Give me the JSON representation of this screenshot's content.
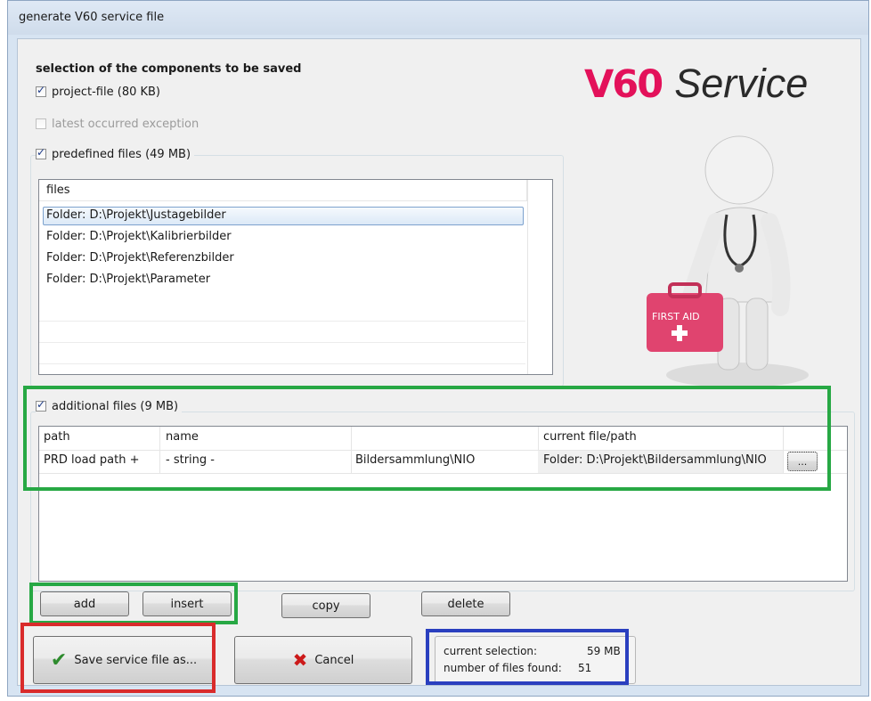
{
  "window": {
    "title": "generate V60 service file"
  },
  "selection_heading": "selection of the components to be saved",
  "checkboxes": {
    "project_file": "project-file (80 KB)",
    "latest_exception": "latest occurred exception",
    "predefined_files": "predefined files (49 MB)",
    "additional_files": "additional files (9 MB)"
  },
  "logo": {
    "brand": "V60",
    "product": "Service"
  },
  "illustration": {
    "kit_label": "FIRST AID"
  },
  "predefined_list": {
    "header": "files",
    "items": [
      "Folder: D:\\Projekt\\Justagebilder",
      "Folder: D:\\Projekt\\Kalibrierbilder",
      "Folder: D:\\Projekt\\Referenzbilder",
      "Folder: D:\\Projekt\\Parameter"
    ]
  },
  "additional_table": {
    "headers": [
      "path",
      "name",
      "",
      "current file/path"
    ],
    "rows": [
      [
        "PRD load path +",
        "- string -",
        "Bildersammlung\\NIO",
        "Folder: D:\\Projekt\\Bildersammlung\\NIO"
      ]
    ],
    "browse_label": "..."
  },
  "buttons": {
    "add": "add",
    "insert": "insert",
    "copy": "copy",
    "delete": "delete",
    "save": "Save service file as...",
    "cancel": "Cancel"
  },
  "stats": {
    "current_selection_label": "current selection:",
    "current_selection_value": "59 MB",
    "files_found_label": "number of files found:",
    "files_found_value": "51"
  },
  "colors": {
    "highlight_green": "#27a844",
    "highlight_red": "#d92b2b",
    "highlight_blue": "#2a3fbf",
    "logo_red": "#e3115a",
    "checkmark_green": "#2e8b2e",
    "cancel_red": "#cc1a1a"
  }
}
